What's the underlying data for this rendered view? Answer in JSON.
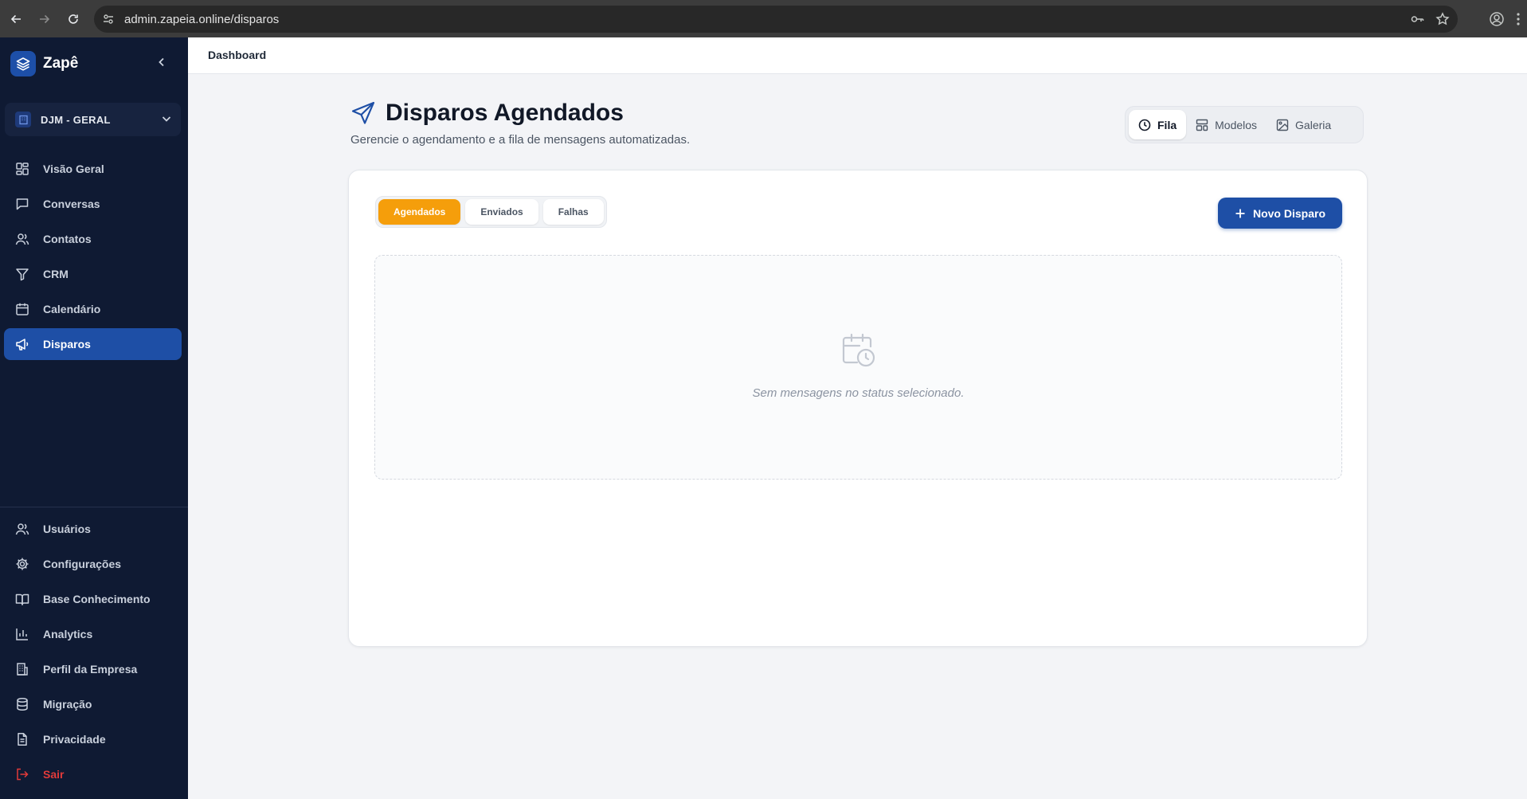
{
  "browser": {
    "url": "admin.zapeia.online/disparos"
  },
  "sidebar": {
    "brand": "Zapê",
    "workspace": "DJM - GERAL",
    "items": [
      {
        "label": "Visão Geral",
        "icon": "grid-icon",
        "active": false
      },
      {
        "label": "Conversas",
        "icon": "chat-icon",
        "active": false
      },
      {
        "label": "Contatos",
        "icon": "users-icon",
        "active": false
      },
      {
        "label": "CRM",
        "icon": "funnel-icon",
        "active": false
      },
      {
        "label": "Calendário",
        "icon": "calendar-icon",
        "active": false
      },
      {
        "label": "Disparos",
        "icon": "megaphone-icon",
        "active": true
      }
    ],
    "bottom_items": [
      {
        "label": "Usuários",
        "icon": "users-icon"
      },
      {
        "label": "Configurações",
        "icon": "gear-icon"
      },
      {
        "label": "Base Conhecimento",
        "icon": "book-icon"
      },
      {
        "label": "Analytics",
        "icon": "bar-chart-icon"
      },
      {
        "label": "Perfil da Empresa",
        "icon": "building-icon"
      },
      {
        "label": "Migração",
        "icon": "database-icon"
      },
      {
        "label": "Privacidade",
        "icon": "document-icon"
      },
      {
        "label": "Sair",
        "icon": "logout-icon"
      }
    ]
  },
  "topbar": {
    "title": "Dashboard"
  },
  "page": {
    "title": "Disparos Agendados",
    "subtitle": "Gerencie o agendamento e a fila de mensagens automatizadas."
  },
  "view_switch": {
    "fila": "Fila",
    "modelos": "Modelos",
    "galeria": "Galeria",
    "active": "Fila"
  },
  "status_tabs": {
    "agendados": "Agendados",
    "enviados": "Enviados",
    "falhas": "Falhas",
    "active": "Agendados"
  },
  "new_button": "Novo Disparo",
  "empty_state": {
    "message": "Sem mensagens no status selecionado."
  },
  "colors": {
    "sidebar_bg": "#0f1a33",
    "accent": "#1e4fa6",
    "active_tab": "#f59e0b",
    "logout": "#e23a3a"
  }
}
